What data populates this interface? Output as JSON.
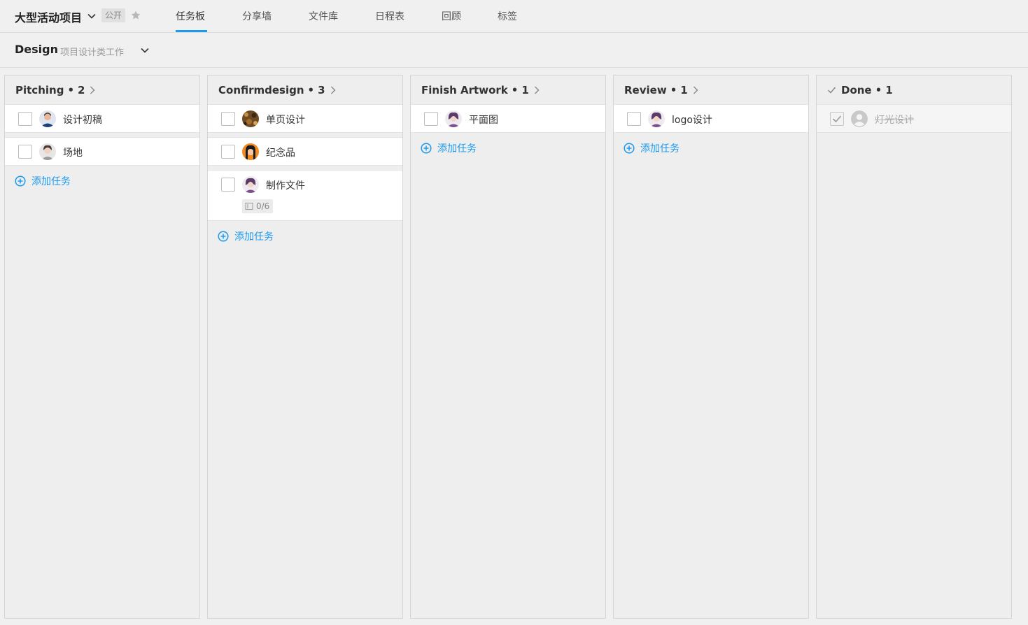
{
  "project": {
    "title": "大型活动项目",
    "visibility": "公开",
    "tabs": [
      {
        "label": "任务板",
        "active": true
      },
      {
        "label": "分享墙",
        "active": false
      },
      {
        "label": "文件库",
        "active": false
      },
      {
        "label": "日程表",
        "active": false
      },
      {
        "label": "回顾",
        "active": false
      },
      {
        "label": "标签",
        "active": false
      }
    ]
  },
  "board": {
    "name": "Design",
    "description": "项目设计类工作"
  },
  "accent_color": "#1b9aee",
  "add_task_label": "添加任务",
  "columns": [
    {
      "name": "Pitching",
      "count": "2",
      "done": false,
      "tasks": [
        {
          "title": "设计初稿",
          "checked": false,
          "avatar": "avatar-man-dark-shirt"
        },
        {
          "title": "场地",
          "checked": false,
          "avatar": "avatar-woman-grey"
        }
      ]
    },
    {
      "name": "Confirmdesign",
      "count": "3",
      "done": false,
      "tasks": [
        {
          "title": "单页设计",
          "checked": false,
          "avatar": "avatar-pattern-brown"
        },
        {
          "title": "纪念品",
          "checked": false,
          "avatar": "avatar-orange"
        },
        {
          "title": "制作文件",
          "checked": false,
          "avatar": "avatar-woman-purple",
          "subtasks": "0/6"
        }
      ]
    },
    {
      "name": "Finish Artwork",
      "count": "1",
      "done": false,
      "tasks": [
        {
          "title": "平面图",
          "checked": false,
          "avatar": "avatar-woman-purple"
        }
      ]
    },
    {
      "name": "Review",
      "count": "1",
      "done": false,
      "tasks": [
        {
          "title": "logo设计",
          "checked": false,
          "avatar": "avatar-woman-purple"
        }
      ]
    },
    {
      "name": "Done",
      "count": "1",
      "done": true,
      "tasks": [
        {
          "title": "灯光设计",
          "checked": true,
          "avatar": "avatar-default-grey"
        }
      ]
    }
  ]
}
